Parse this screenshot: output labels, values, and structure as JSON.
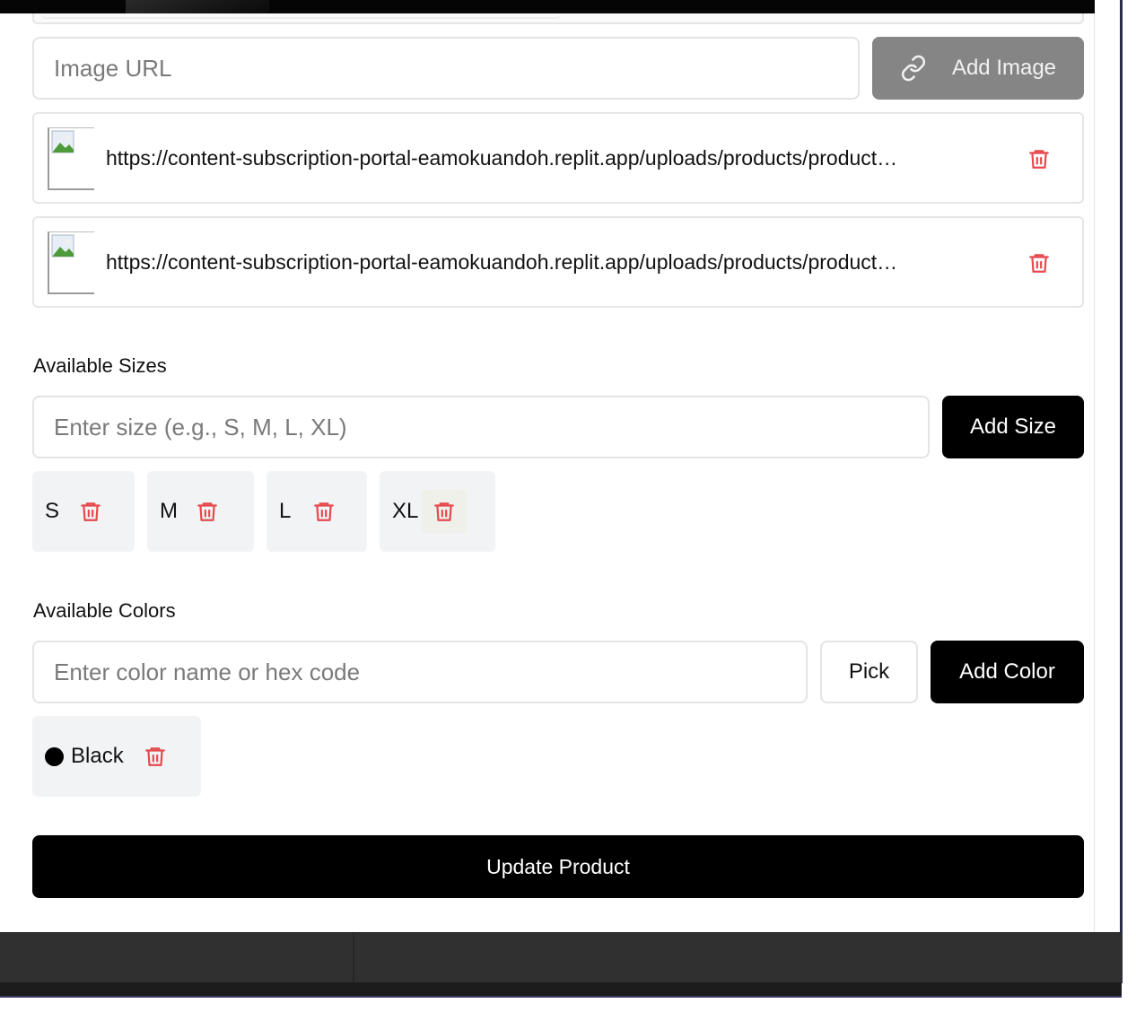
{
  "images": {
    "url_placeholder": "Image URL",
    "add_button": "Add Image",
    "items": [
      {
        "url": "https://content-subscription-portal-eamokuandoh.replit.app/uploads/products/product…"
      },
      {
        "url": "https://content-subscription-portal-eamokuandoh.replit.app/uploads/products/product…"
      }
    ]
  },
  "sizes": {
    "label": "Available Sizes",
    "placeholder": "Enter size (e.g., S, M, L, XL)",
    "add_button": "Add Size",
    "items": [
      "S",
      "M",
      "L",
      "XL"
    ]
  },
  "colors": {
    "label": "Available Colors",
    "placeholder": "Enter color name or hex code",
    "pick_button": "Pick",
    "add_button": "Add Color",
    "items": [
      {
        "name": "Black",
        "swatch": "#000000"
      }
    ]
  },
  "submit": {
    "label": "Update Product"
  },
  "theme": {
    "accent": "#000000",
    "danger": "#e5484d",
    "chip_bg": "#f2f3f5"
  }
}
